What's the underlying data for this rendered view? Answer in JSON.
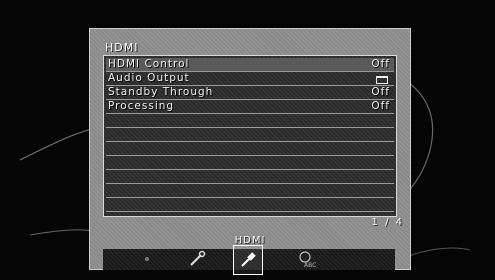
{
  "menu": {
    "title": "HDMI",
    "rows": [
      {
        "label": "HDMI Control",
        "value": "Off",
        "selected": true
      },
      {
        "label": "Audio Output",
        "value_icon": "display-output-icon"
      },
      {
        "label": "Standby Through",
        "value": "Off"
      },
      {
        "label": "Processing",
        "value": "Off"
      }
    ],
    "page_indicator": "1 / 4"
  },
  "bottom_bar": {
    "selected_label": "HDMI",
    "icons": [
      "setup-icon",
      "wrench-icon",
      "hdmi-plug-icon",
      "language-abc-icon"
    ]
  }
}
